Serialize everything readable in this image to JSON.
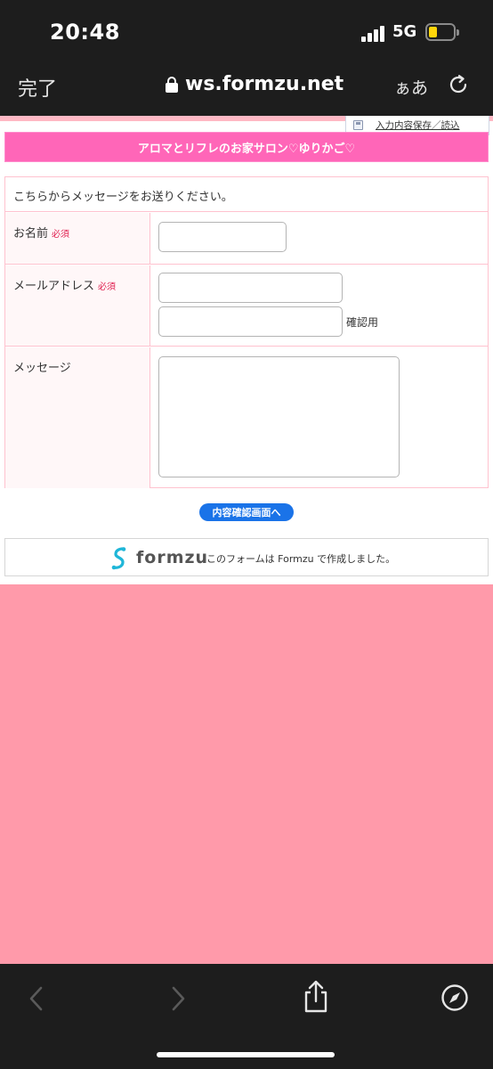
{
  "status_bar": {
    "time": "20:48",
    "network": "5G",
    "battery_level": 0.25,
    "battery_color": "#ffd60a"
  },
  "browser": {
    "done_label": "完了",
    "url": "ws.formzu.net",
    "text_size_label": "ぁあ",
    "icons": [
      "lock-icon",
      "reload-icon",
      "back-icon",
      "forward-icon",
      "share-icon",
      "compass-icon"
    ]
  },
  "form": {
    "save_load_link": "入力内容保存／読込",
    "title": "アロマとリフレのお家サロン♡ゆりかご♡",
    "intro": "こちらからメッセージをお送りください。",
    "fields": {
      "name_label": "お名前",
      "email_label": "メールアドレス",
      "message_label": "メッセージ",
      "required_badge": "必須",
      "confirm_label": "確認用"
    },
    "submit_label": "内容確認画面へ",
    "footer": {
      "brand": "formzu",
      "note": "このフォームは Formzu で作成しました。"
    }
  },
  "colors": {
    "title_bar": "#ff66b8",
    "page_background": "#ff9aaa",
    "submit_button": "#1a73e8",
    "required_text": "#e02050"
  }
}
